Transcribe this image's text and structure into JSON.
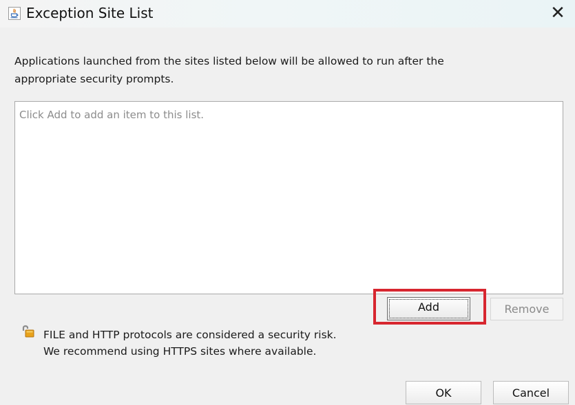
{
  "window": {
    "title": "Exception Site List",
    "app_icon": "java-icon",
    "close_label": "✕"
  },
  "description": {
    "line1": "Applications launched from the sites listed below will be allowed to run after the",
    "line2": "appropriate security prompts."
  },
  "site_list": {
    "placeholder": "Click Add to add an item to this list.",
    "items": []
  },
  "list_buttons": {
    "add_label": "Add",
    "remove_label": "Remove",
    "remove_enabled": false
  },
  "warning": {
    "icon": "unlocked-padlock-icon",
    "line1": "FILE and HTTP protocols are considered a security risk.",
    "line2": "We recommend using HTTPS sites where available."
  },
  "footer": {
    "ok_label": "OK",
    "cancel_label": "Cancel"
  },
  "colors": {
    "highlight": "#d7262f",
    "disabled_text": "#8a8a8a"
  }
}
